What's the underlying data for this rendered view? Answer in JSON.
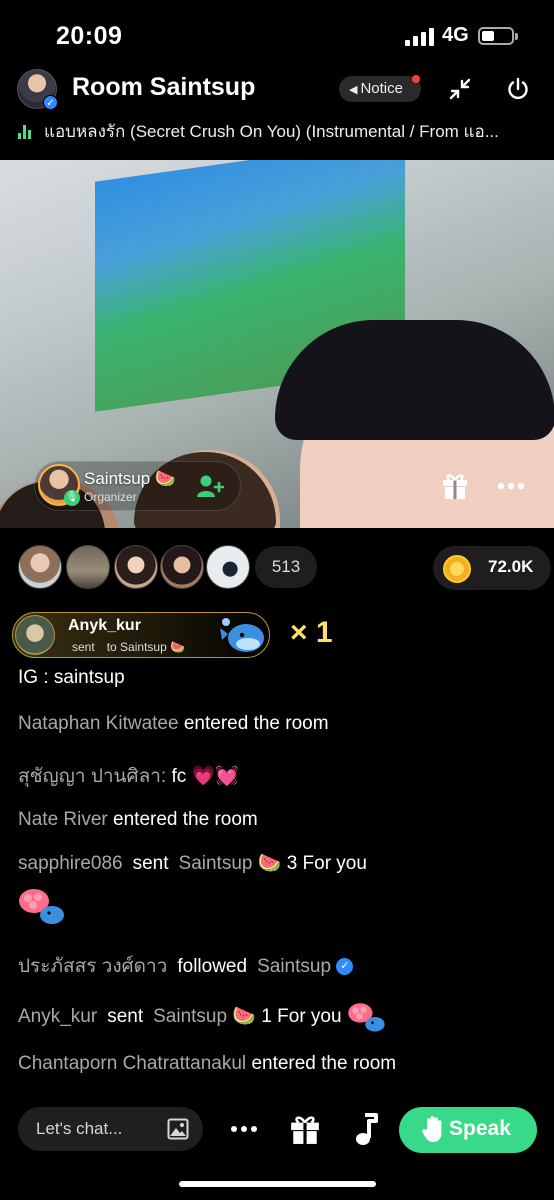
{
  "status_bar": {
    "time": "20:09",
    "network": "4G"
  },
  "room": {
    "title": "Room Saintsup",
    "notice_label": "Notice",
    "now_playing": "แอบหลงรัก (Secret Crush On You) (Instrumental / From แอ..."
  },
  "host": {
    "name": "Saintsup 🍉",
    "role": "Organizer"
  },
  "audience": {
    "count": "513"
  },
  "coins": {
    "value": "72.0K"
  },
  "gift_banner": {
    "sender": "Anyk_kur",
    "sent_word": "sent",
    "to_word": "to",
    "recipient": "Saintsup 🍉",
    "count": "× 1"
  },
  "chat": [
    {
      "text": "IG : saintsup"
    },
    {
      "user": "Nataphan Kitwatee",
      "text": "entered the room"
    },
    {
      "user": "สุชัญญา ปานศิลา:",
      "text": "fc",
      "emoji": "💗💓"
    },
    {
      "user": "Nate River",
      "text": "entered the room"
    },
    {
      "user": "sapphire086",
      "action": "sent",
      "target": "Saintsup 🍉",
      "text": "3 For you"
    },
    {
      "user": "ประภัสสร วงศ์ดาว",
      "action": "followed",
      "target": "Saintsup"
    },
    {
      "user": "Anyk_kur",
      "action": "sent",
      "target": "Saintsup 🍉",
      "text": "1 For you"
    },
    {
      "user": "Chantaporn Chatrattanakul",
      "text": "entered the room"
    }
  ],
  "bottom_bar": {
    "chat_placeholder": "Let's chat...",
    "speak_label": "Speak"
  },
  "colors": {
    "speak_green": "#39d98a",
    "gift_gold": "#ffe066",
    "username_gray": "#a8a8a8",
    "notice_dot": "#ff3b3b"
  }
}
